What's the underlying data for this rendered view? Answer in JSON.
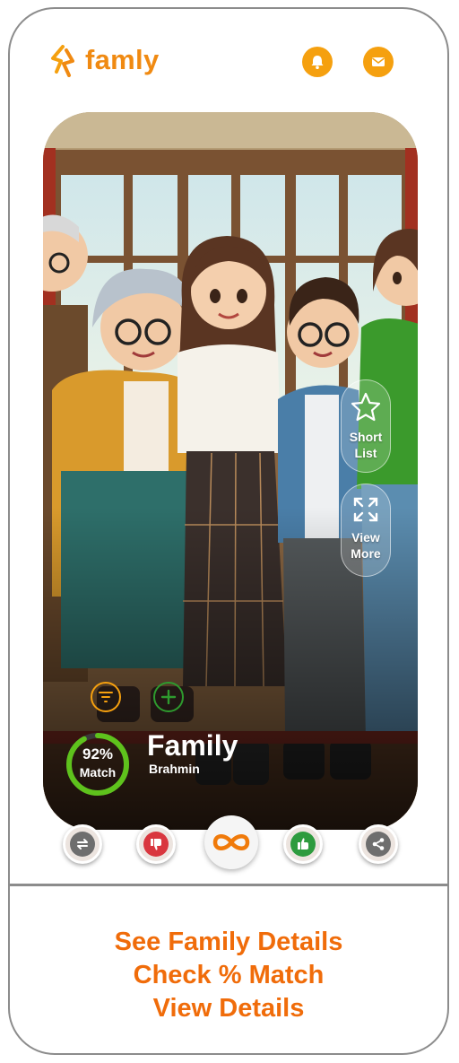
{
  "header": {
    "brand": "famly",
    "brand_color": "#f08a12",
    "icons": [
      "logo-icon",
      "bell-icon",
      "mail-icon"
    ]
  },
  "profile": {
    "name": "Family",
    "caste": "Brahmin",
    "match_percent": 92,
    "match_text": "92%",
    "match_label": "Match"
  },
  "side_actions": {
    "short_list": "Short\nList",
    "view_more": "View\nMore"
  },
  "bottom_actions": [
    "refresh-icon",
    "dislike-icon",
    "infinity-icon",
    "like-icon",
    "share-icon"
  ],
  "tagline": {
    "line1": "See Family Details",
    "line2": "Check % Match",
    "line3": "View Details"
  }
}
